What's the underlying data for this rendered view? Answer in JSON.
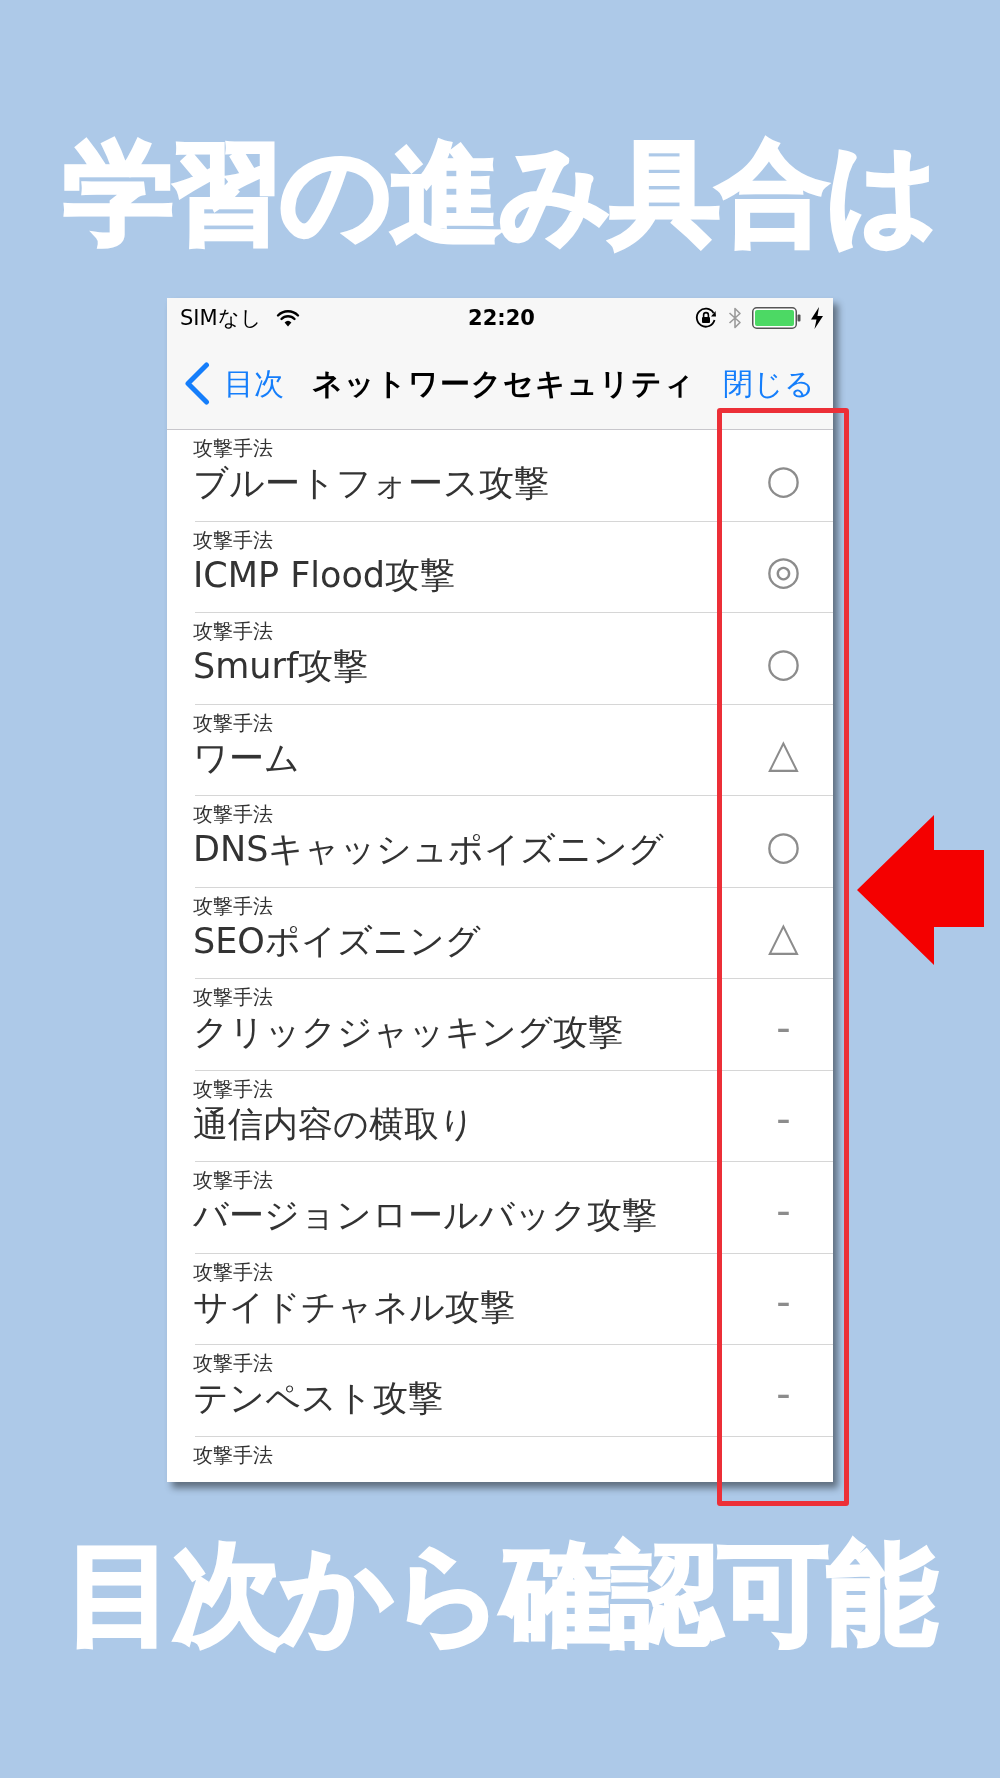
{
  "headline_top": "学習の進み具合は",
  "phone": {
    "status_bar": {
      "carrier": "SIMなし",
      "time": "22:20"
    },
    "nav_bar": {
      "back": "目次",
      "title": "ネットワークセキュリティ",
      "close": "閉じる"
    },
    "rows": [
      {
        "category": "攻撃手法",
        "title": "ブルートフォース攻撃",
        "mark": "○"
      },
      {
        "category": "攻撃手法",
        "title": "ICMP Flood攻撃",
        "mark": "◎"
      },
      {
        "category": "攻撃手法",
        "title": "Smurf攻撃",
        "mark": "○"
      },
      {
        "category": "攻撃手法",
        "title": "ワーム",
        "mark": "△"
      },
      {
        "category": "攻撃手法",
        "title": "DNSキャッシュポイズニング",
        "mark": "○"
      },
      {
        "category": "攻撃手法",
        "title": "SEOポイズニング",
        "mark": "△"
      },
      {
        "category": "攻撃手法",
        "title": "クリックジャッキング攻撃",
        "mark": "-"
      },
      {
        "category": "攻撃手法",
        "title": "通信内容の横取り",
        "mark": "-"
      },
      {
        "category": "攻撃手法",
        "title": "バージョンロールバック攻撃",
        "mark": "-"
      },
      {
        "category": "攻撃手法",
        "title": "サイドチャネル攻撃",
        "mark": "-"
      },
      {
        "category": "攻撃手法",
        "title": "テンペスト攻撃",
        "mark": "-"
      },
      {
        "category": "攻撃手法"
      }
    ]
  },
  "headline_bottom": "目次から確認可能"
}
